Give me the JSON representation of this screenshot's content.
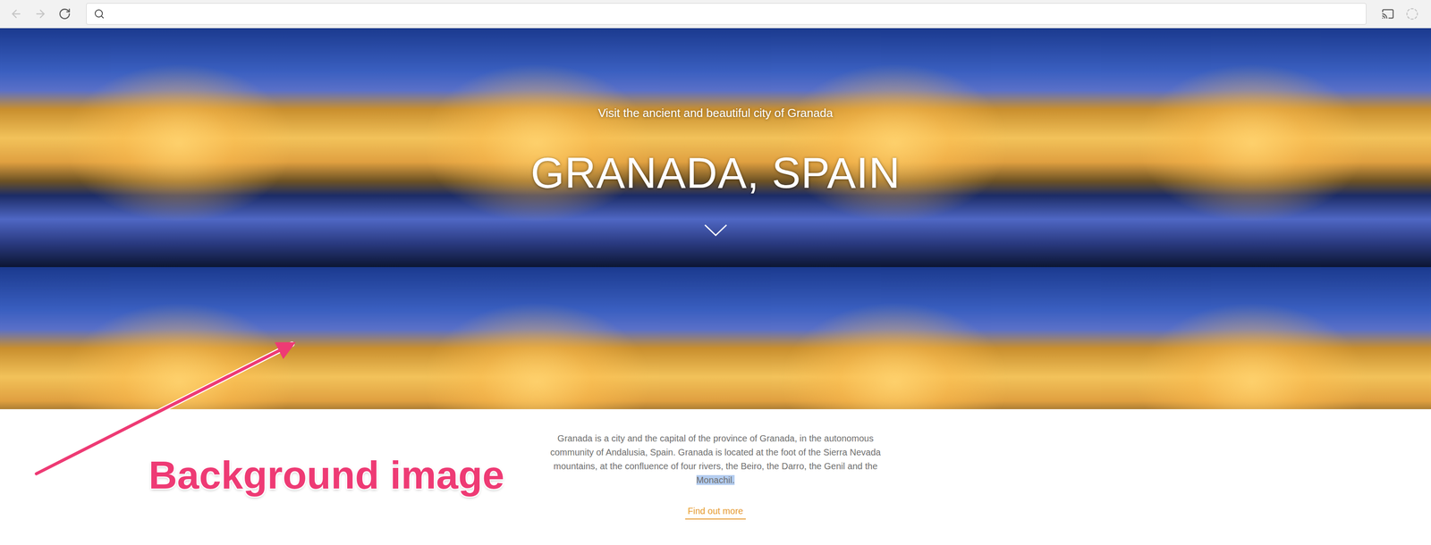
{
  "browser": {
    "back_disabled": true,
    "forward_disabled": true,
    "address": ""
  },
  "hero": {
    "subtitle": "Visit the ancient and beautiful city of Granada",
    "title": "GRANADA, SPAIN",
    "scroll_icon": "chevron-down"
  },
  "content": {
    "paragraph": "Granada is a city and the capital of the province of Granada, in the autonomous community of Andalusia, Spain. Granada is located at the foot of the Sierra Nevada mountains, at the confluence of four rivers, the Beiro, the Darro, the Genil and the",
    "selected_text": "Monachil.",
    "link": "Find out more"
  },
  "annotation": {
    "label": "Background image"
  }
}
